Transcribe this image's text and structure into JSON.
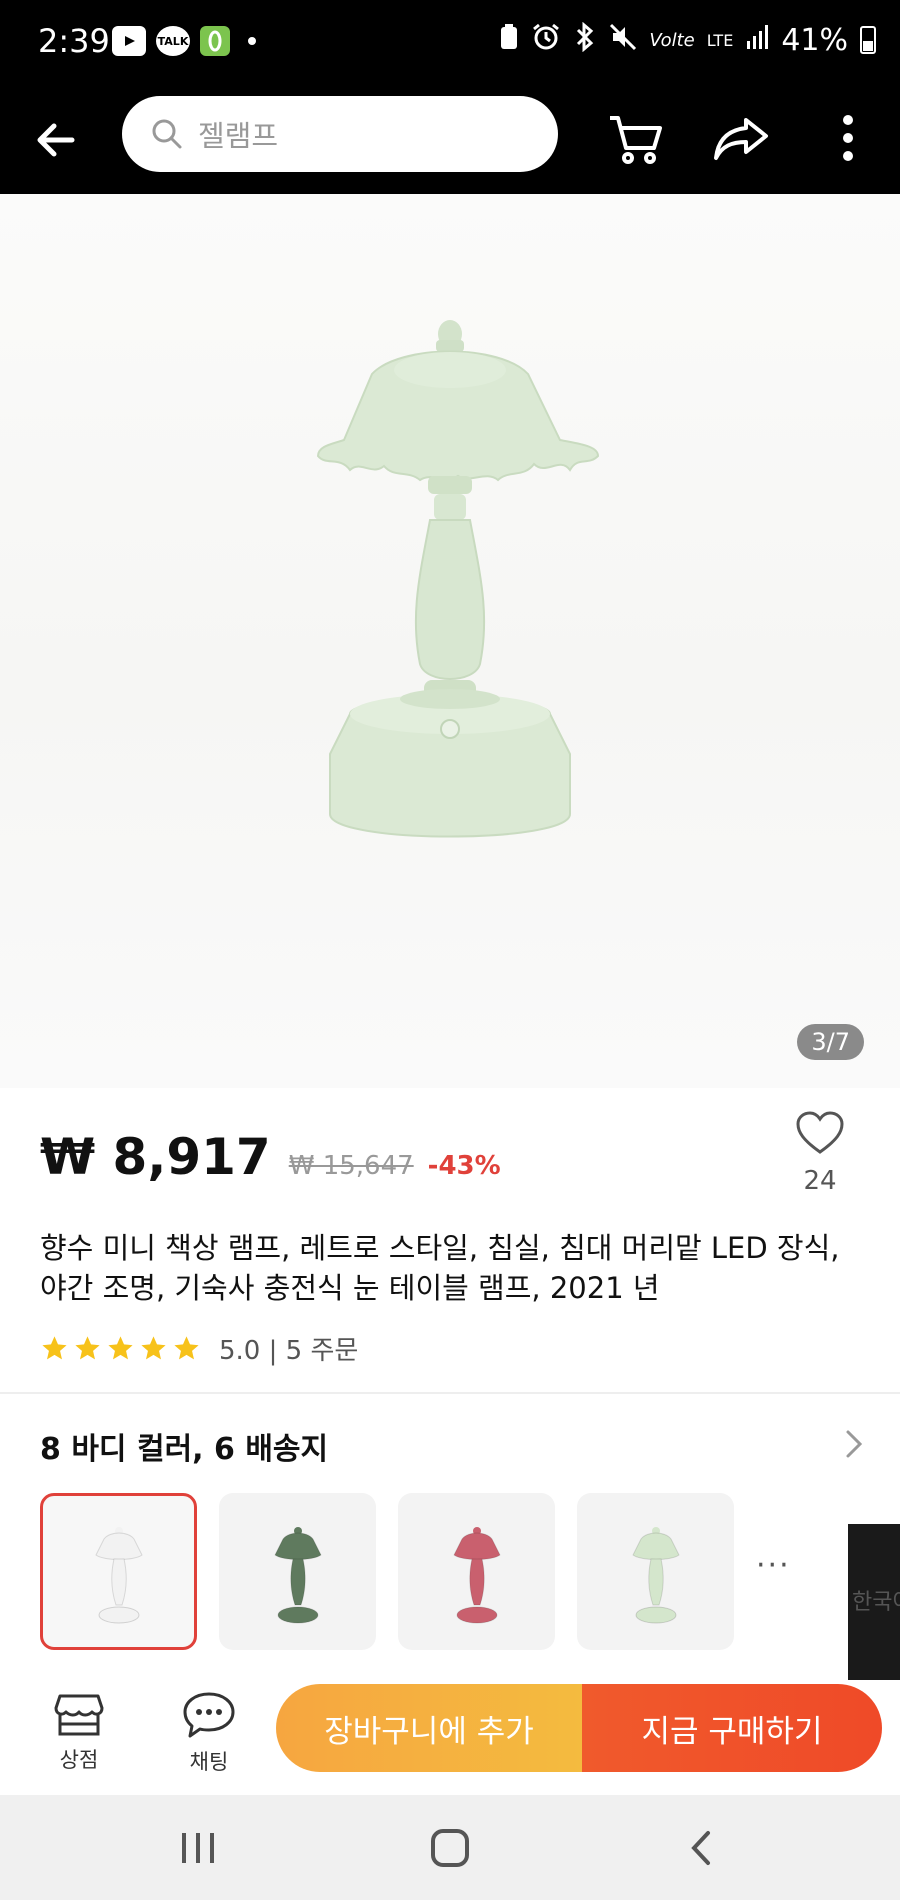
{
  "status_bar": {
    "time": "2:39",
    "left_icons": [
      "youtube-icon",
      "kakaotalk-icon",
      "app-notification-icon"
    ],
    "right_icons": [
      "battery-saver-icon",
      "alarm-icon",
      "bluetooth-icon",
      "mute-icon",
      "volte-icon",
      "lte-icon",
      "signal-icon"
    ],
    "battery_percent": "41%",
    "talk_label": "TALK"
  },
  "header": {
    "search_query": "젤램프",
    "icons": [
      "back-arrow-icon",
      "search-icon",
      "cart-icon",
      "share-icon",
      "more-vertical-icon"
    ]
  },
  "gallery": {
    "counter": "3/7",
    "colors": {
      "lamp": "#dbe9d4",
      "lamp_shadow": "#c7d9bf",
      "background": "#f7f7f6"
    }
  },
  "product": {
    "price": "₩ 8,917",
    "original_price": "₩ 15,647",
    "discount": "-43%",
    "wishlist_count": "24",
    "title": "향수 미니 책상 램프, 레트로 스타일, 침실, 침대 머리맡 LED 장식, 야간 조명, 기숙사 충전식 눈 테이블 램프, 2021 년",
    "rating_value": 5,
    "rating_text": "5.0 | 5 주문"
  },
  "variants": {
    "title": "8 바디 컬러, 6 배송지",
    "thumbnails": [
      {
        "name": "white-lamp",
        "color": "#f2f2f2",
        "selected": true
      },
      {
        "name": "green-lamp",
        "color": "#5f7a5e",
        "selected": false
      },
      {
        "name": "pink-lamp",
        "color": "#c9606e",
        "selected": false
      },
      {
        "name": "mint-lamp",
        "color": "#d4e6cc",
        "selected": false
      }
    ],
    "more": "···"
  },
  "side_video": {
    "text": "한국어"
  },
  "actions": {
    "store_label": "상점",
    "chat_label": "채팅",
    "add_to_cart": "장바구니에 추가",
    "buy_now": "지금 구매하기"
  },
  "colors": {
    "accent_red": "#e0413a",
    "cart_orange": "#f6a640",
    "buy_red": "#ef4a28",
    "star_yellow": "#f7c21a"
  }
}
